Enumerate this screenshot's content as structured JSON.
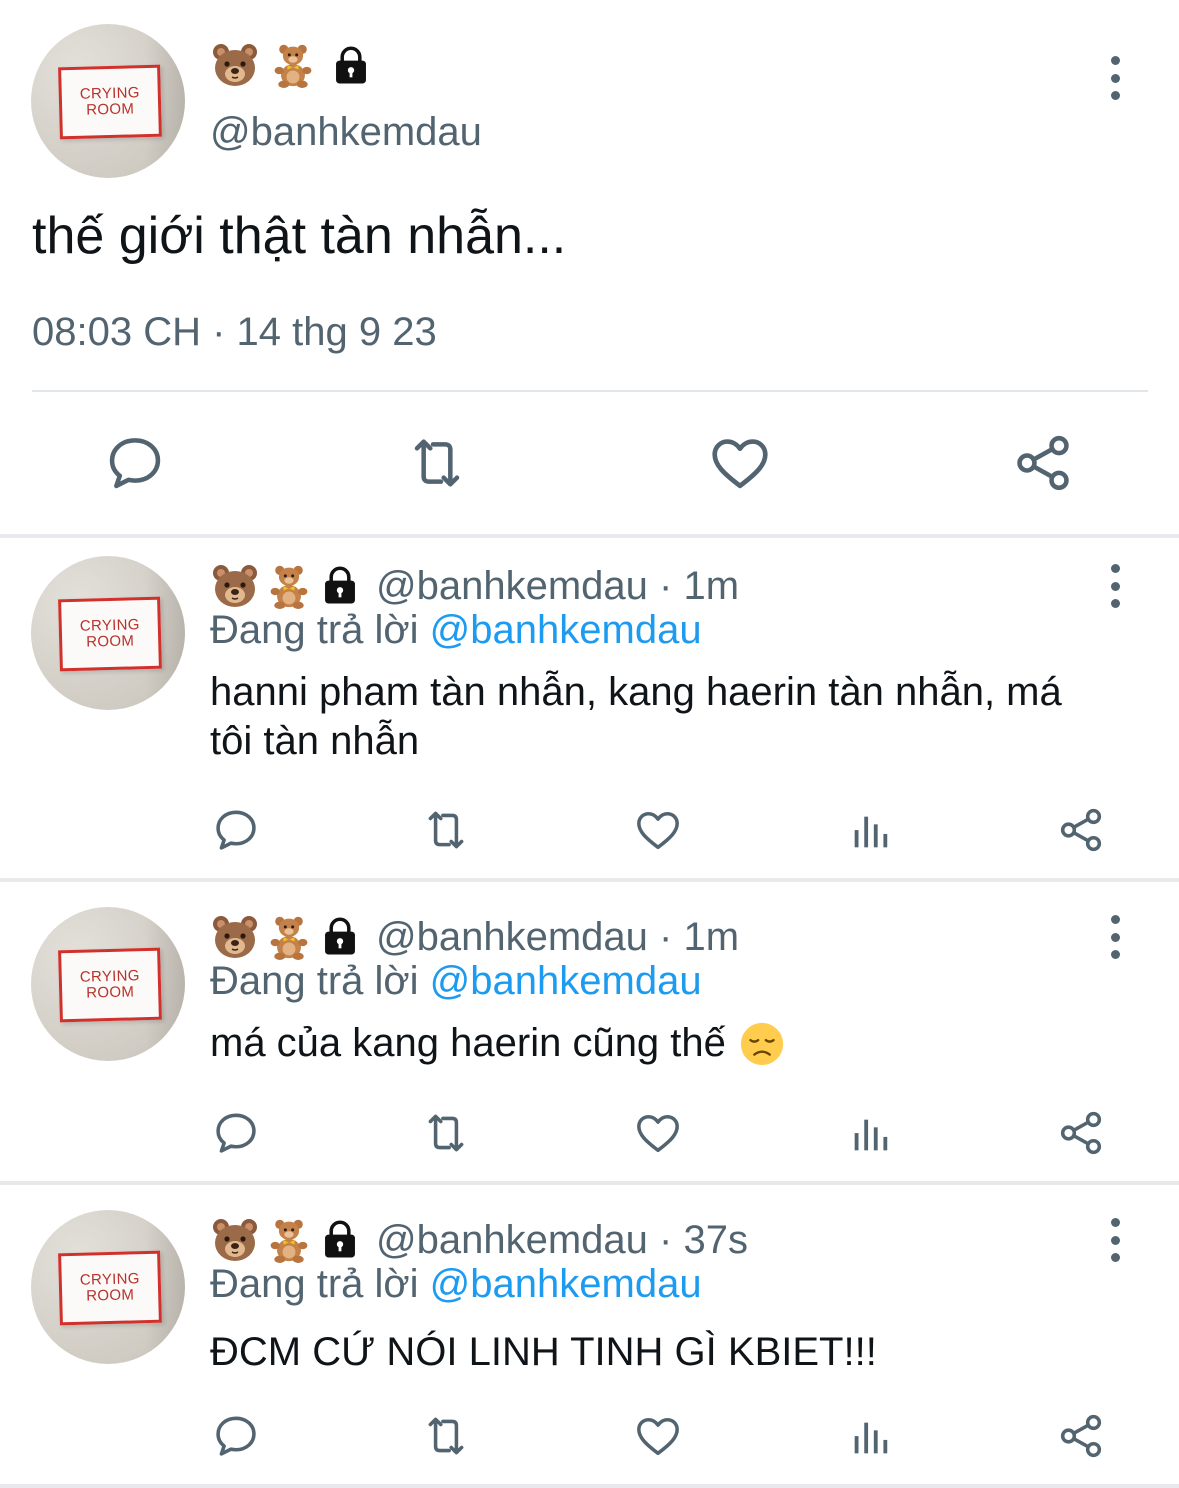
{
  "main_tweet": {
    "author_emojis": [
      "bear-face",
      "teddy-bear",
      "lock"
    ],
    "handle": "@banhkemdau",
    "avatar_text": [
      "CRYING",
      "ROOM"
    ],
    "text": "thế giới thật tàn nhẫn...",
    "meta": "08:03 CH · 14 thg 9 23"
  },
  "replies": [
    {
      "handle": "@banhkemdau",
      "time": "1m",
      "replying_prefix": "Đang trả lời",
      "replying_to": "@banhkemdau",
      "text": "hanni pham tàn nhẫn, kang haerin tàn nhẫn, má tôi tàn nhẫn"
    },
    {
      "handle": "@banhkemdau",
      "time": "1m",
      "replying_prefix": "Đang trả lời",
      "replying_to": "@banhkemdau",
      "text": "má của kang haerin cũng thế",
      "trailing_emoji": "😞"
    },
    {
      "handle": "@banhkemdau",
      "time": "37s",
      "replying_prefix": "Đang trả lời",
      "replying_to": "@banhkemdau",
      "text": "ĐCM CỨ NÓI LINH TINH GÌ KBIET!!!"
    }
  ],
  "separator": " · ",
  "colors": {
    "secondary_text": "#536471",
    "link": "#1d9bf0",
    "primary_text": "#0f1419",
    "divider": "#e7e9ec"
  },
  "icons": [
    "reply-icon",
    "retweet-icon",
    "like-icon",
    "views-icon",
    "share-icon",
    "more-icon",
    "lock-icon",
    "bear-face-icon",
    "teddy-bear-icon"
  ]
}
